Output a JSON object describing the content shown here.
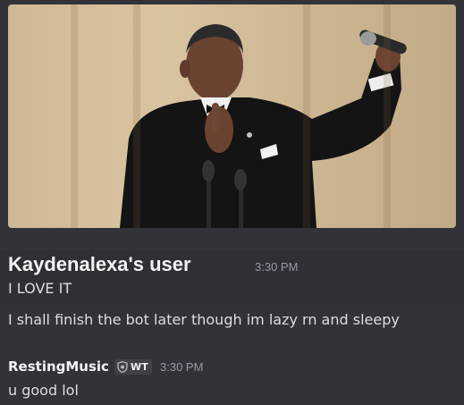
{
  "attachment": {
    "kind": "image",
    "subject": "man in tuxedo holding a microphone up"
  },
  "messages": [
    {
      "author": "Kaydenalexa's user",
      "timestamp": "3:30 PM",
      "lines": [
        "I LOVE IT",
        "I shall finish the bot later though im lazy rn and sleepy"
      ]
    },
    {
      "author": "RestingMusic",
      "tag": {
        "icon": "shield-icon",
        "label": "WT"
      },
      "timestamp": "3:30 PM",
      "lines": [
        "u good lol"
      ]
    }
  ],
  "colors": {
    "background": "#313338",
    "author": "#f2f3f5",
    "text": "#dbdee1",
    "timestamp": "#949ba4"
  }
}
